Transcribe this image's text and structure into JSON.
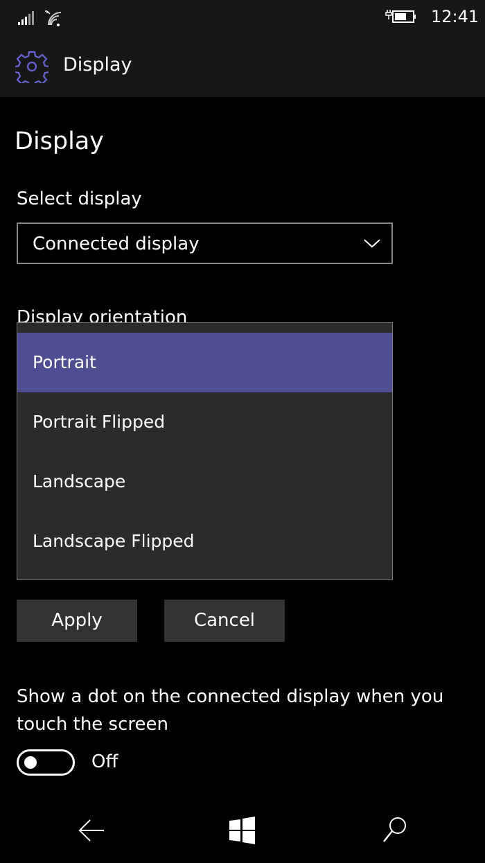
{
  "status_bar": {
    "time": "12:41",
    "icons": [
      "signal-icon",
      "wifi-icon",
      "battery-charging-icon"
    ]
  },
  "header": {
    "title": "Display",
    "icon": "gear-icon",
    "accent": "#5a55c4"
  },
  "page": {
    "title": "Display"
  },
  "select_display": {
    "label": "Select display",
    "value": "Connected display"
  },
  "orientation": {
    "label": "Display orientation",
    "options": [
      "Portrait",
      "Portrait Flipped",
      "Landscape",
      "Landscape Flipped"
    ],
    "selected": "Portrait",
    "selected_color": "#4f4e92"
  },
  "buttons": {
    "apply": "Apply",
    "cancel": "Cancel"
  },
  "dot_setting": {
    "label": "Show a dot on the connected display when you touch the screen",
    "state": "Off"
  },
  "nav": {
    "icons": [
      "back-icon",
      "windows-icon",
      "search-icon"
    ]
  }
}
